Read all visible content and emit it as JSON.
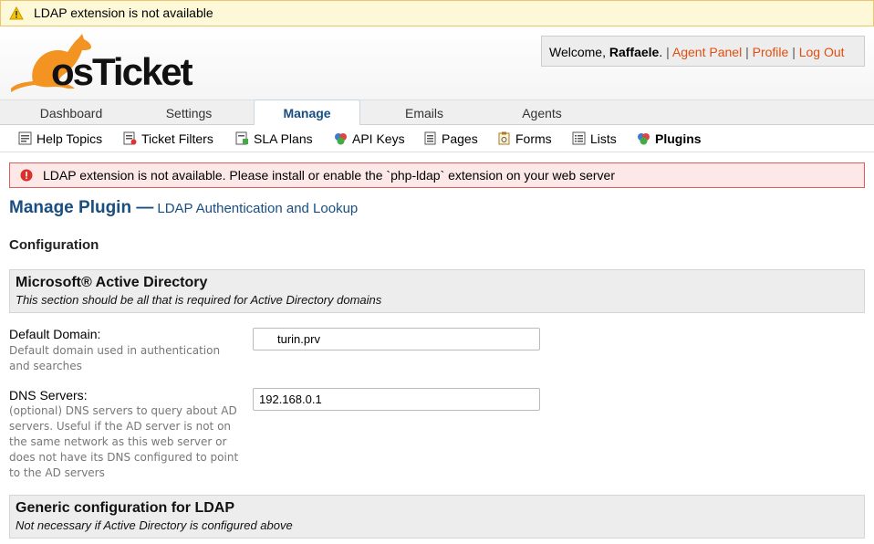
{
  "warning": {
    "text": "LDAP extension is not available"
  },
  "header": {
    "logo_text": "osTicket",
    "welcome_prefix": "Welcome,",
    "user_name": "Raffaele",
    "welcome_suffix": ".",
    "sep": "|",
    "links": [
      "Agent Panel",
      "Profile",
      "Log Out"
    ]
  },
  "nav": {
    "tabs": [
      {
        "label": "Dashboard"
      },
      {
        "label": "Settings"
      },
      {
        "label": "Manage"
      },
      {
        "label": "Emails"
      },
      {
        "label": "Agents"
      }
    ],
    "active_tab": "Manage"
  },
  "subnav": {
    "items": [
      {
        "label": "Help Topics"
      },
      {
        "label": "Ticket Filters"
      },
      {
        "label": "SLA Plans"
      },
      {
        "label": "API Keys"
      },
      {
        "label": "Pages"
      },
      {
        "label": "Forms"
      },
      {
        "label": "Lists"
      },
      {
        "label": "Plugins"
      }
    ],
    "active_item": "Plugins"
  },
  "error": {
    "text": "LDAP extension is not available. Please install or enable the `php-ldap` extension on your web server"
  },
  "page": {
    "title": "Manage Plugin —",
    "subtitle": "LDAP Authentication and Lookup",
    "section": "Configuration"
  },
  "groups": {
    "ad": {
      "title": "Microsoft® Active Directory",
      "desc": "This section should be all that is required for Active Directory domains"
    },
    "generic": {
      "title": "Generic configuration for LDAP",
      "desc": "Not necessary if Active Directory is configured above"
    }
  },
  "fields": {
    "default_domain": {
      "label": "Default Domain",
      "colon": ":",
      "hint": "Default domain used in authentication and searches",
      "value": "turin.prv"
    },
    "dns_servers": {
      "label": "DNS Servers",
      "colon": ":",
      "hint": "(optional) DNS servers to query about AD servers. Useful if the AD server is not on the same network as this web server or does not have its DNS configured to point to the AD servers",
      "value": "192.168.0.1"
    }
  },
  "colors": {
    "accent": "#184e81",
    "link": "#e04e10",
    "logo_orange": "#f39322"
  }
}
